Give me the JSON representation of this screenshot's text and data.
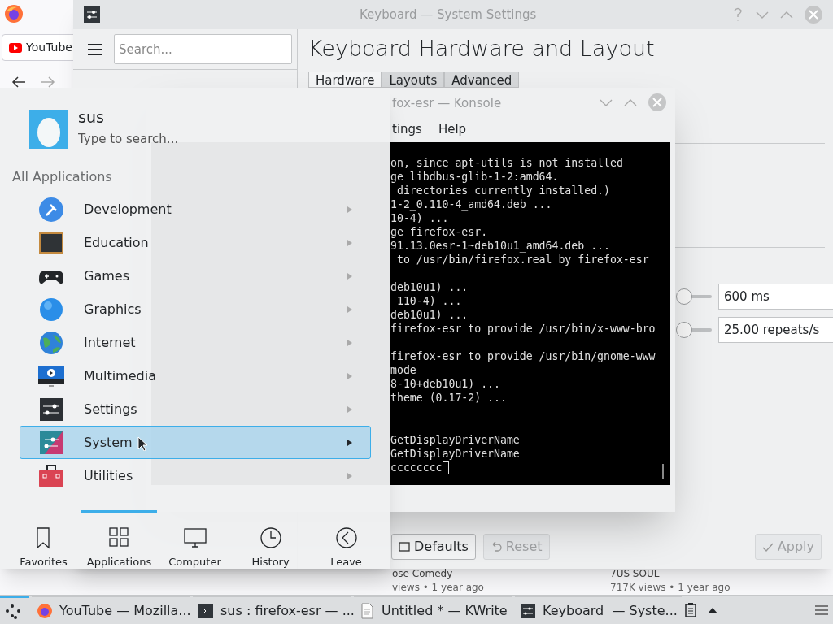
{
  "browser": {
    "tab": "YouTube",
    "videos": [
      {
        "title": "ose Comedy",
        "meta": "views • 1 year ago"
      },
      {
        "title": "7US SOUL",
        "meta": "717K views • 1 year ago"
      }
    ]
  },
  "settings": {
    "title": "Keyboard — System Settings",
    "search": {
      "placeholder": "Search..."
    },
    "heading": "Keyboard Hardware and Layout",
    "tabs": [
      {
        "label": "Hardware",
        "selected": true
      },
      {
        "label": "Layouts",
        "selected": false
      },
      {
        "label": "Advanced",
        "selected": false
      }
    ],
    "rows": [
      {
        "level": 0,
        "value": "600 ms"
      },
      {
        "level": 0,
        "value": "25.00 repeats/s"
      }
    ],
    "buttons": [
      {
        "kind": "defaults",
        "label": "Defaults",
        "disabled": false
      },
      {
        "kind": "reset",
        "label": "Reset",
        "disabled": true
      },
      {
        "kind": "apply",
        "label": "Apply",
        "disabled": true
      }
    ]
  },
  "konsole": {
    "title": "fox-esr — Konsole",
    "menu": [
      "tings",
      "Help"
    ],
    "blocks": [
      [
        "on, since apt-utils is not installed",
        "ge libdbus-glib-1-2:amd64.",
        " directories currently installed.)",
        "1-2_0.110-4_amd64.deb ...",
        "10-4) ...",
        "ge firefox-esr.",
        "91.13.0esr-1~deb10u1_amd64.deb ...",
        " to /usr/bin/firefox.real by firefox-esr"
      ],
      [
        "deb10u1) ...",
        " 110-4) ...",
        "deb10u1) ...",
        "firefox-esr to provide /usr/bin/x-www-bro"
      ],
      [
        "firefox-esr to provide /usr/bin/gnome-www",
        "mode",
        "8-10+deb10u1) ...",
        "theme (0.17-2) ..."
      ],
      [
        "GetDisplayDriverName",
        "GetDisplayDriverName",
        "cccccccc"
      ]
    ]
  },
  "launcher": {
    "user": "sus",
    "search": {
      "placeholder": "Type to search..."
    },
    "section": "All Applications",
    "categories": [
      {
        "kind": "development",
        "label": "Development",
        "selected": false
      },
      {
        "kind": "education",
        "label": "Education",
        "selected": false
      },
      {
        "kind": "games",
        "label": "Games",
        "selected": false
      },
      {
        "kind": "graphics",
        "label": "Graphics",
        "selected": false
      },
      {
        "kind": "internet",
        "label": "Internet",
        "selected": false
      },
      {
        "kind": "multimedia",
        "label": "Multimedia",
        "selected": false
      },
      {
        "kind": "settings",
        "label": "Settings",
        "selected": false
      },
      {
        "kind": "system",
        "label": "System",
        "selected": true
      },
      {
        "kind": "utilities",
        "label": "Utilities",
        "selected": false
      }
    ],
    "tabs": [
      {
        "kind": "favorites",
        "label": "Favorites",
        "selected": false
      },
      {
        "kind": "applications",
        "label": "Applications",
        "selected": true
      },
      {
        "kind": "computer",
        "label": "Computer",
        "selected": false
      },
      {
        "kind": "history",
        "label": "History",
        "selected": false
      },
      {
        "kind": "leave",
        "label": "Leave",
        "selected": false
      }
    ]
  },
  "taskbar": {
    "tasks": [
      {
        "kind": "browser",
        "label": "YouTube — Mozilla..."
      },
      {
        "kind": "terminal",
        "label": "sus : firefox-esr — ..."
      },
      {
        "kind": "editor",
        "label": "Untitled * — KWrite"
      },
      {
        "kind": "settings",
        "label": "Keyboard  — Syste..."
      }
    ]
  }
}
